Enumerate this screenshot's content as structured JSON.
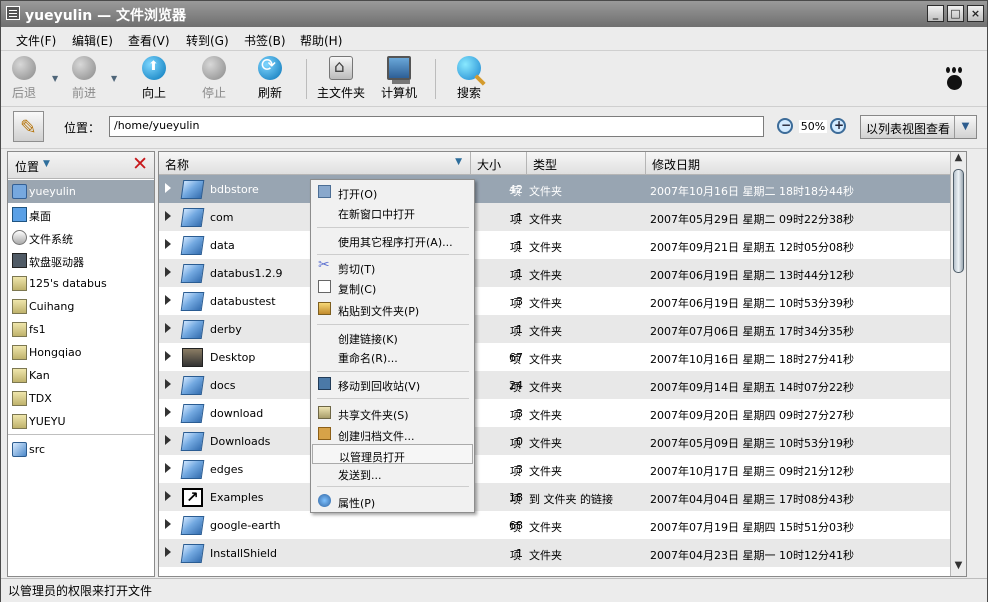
{
  "window": {
    "title": "yueyulin — 文件浏览器",
    "controls": [
      "_",
      "□",
      "×"
    ]
  },
  "menubar": [
    "文件(F)",
    "编辑(E)",
    "查看(V)",
    "转到(G)",
    "书签(B)",
    "帮助(H)"
  ],
  "toolbar": {
    "back": "后退",
    "forward": "前进",
    "up": "向上",
    "stop": "停止",
    "refresh": "刷新",
    "home": "主文件夹",
    "computer": "计算机",
    "search": "搜索"
  },
  "location": {
    "label": "位置：",
    "path": "/home/yueyulin",
    "zoom": "50%",
    "view_mode": "以列表视图查看"
  },
  "sidebar": {
    "header": "位置",
    "items": [
      {
        "label": "yueyulin",
        "icon": "home-folder-icon",
        "selected": true
      },
      {
        "label": "桌面",
        "icon": "desktop-icon"
      },
      {
        "label": "文件系统",
        "icon": "filesystem-icon"
      },
      {
        "label": "软盘驱动器",
        "icon": "floppy-icon"
      },
      {
        "label": "125's databus",
        "icon": "network-folder-icon"
      },
      {
        "label": "Cuihang",
        "icon": "network-folder-icon"
      },
      {
        "label": "fs1",
        "icon": "network-folder-icon"
      },
      {
        "label": "Hongqiao",
        "icon": "network-folder-icon"
      },
      {
        "label": "Kan",
        "icon": "network-folder-icon"
      },
      {
        "label": "TDX",
        "icon": "network-folder-icon"
      },
      {
        "label": "YUEYU",
        "icon": "network-folder-icon"
      },
      {
        "label": "src",
        "icon": "folder-icon"
      }
    ]
  },
  "filelist": {
    "columns": {
      "name": "名称",
      "size": "大小",
      "type": "类型",
      "date": "修改日期"
    },
    "rows": [
      {
        "name": "bdbstore",
        "size": "42",
        "unit": "项",
        "type": "文件夹",
        "date": "2007年10月16日 星期二 18时18分44秒",
        "selected": true
      },
      {
        "name": "com",
        "size": "1",
        "unit": "项",
        "type": "文件夹",
        "date": "2007年05月29日 星期二 09时22分38秒"
      },
      {
        "name": "data",
        "size": "1",
        "unit": "项",
        "type": "文件夹",
        "date": "2007年09月21日 星期五 12时05分08秒"
      },
      {
        "name": "databus1.2.9",
        "size": "1",
        "unit": "项",
        "type": "文件夹",
        "date": "2007年06月19日 星期二 13时44分12秒"
      },
      {
        "name": "databustest",
        "size": "3",
        "unit": "项",
        "type": "文件夹",
        "date": "2007年06月19日 星期二 10时53分39秒"
      },
      {
        "name": "derby",
        "size": "1",
        "unit": "项",
        "type": "文件夹",
        "date": "2007年07月06日 星期五 17时34分35秒"
      },
      {
        "name": "Desktop",
        "size": "67",
        "unit": "项",
        "type": "文件夹",
        "date": "2007年10月16日 星期二 18时27分41秒",
        "icon": "desktop"
      },
      {
        "name": "docs",
        "size": "24",
        "unit": "项",
        "type": "文件夹",
        "date": "2007年09月14日 星期五 14时07分22秒"
      },
      {
        "name": "download",
        "size": "3",
        "unit": "项",
        "type": "文件夹",
        "date": "2007年09月20日 星期四 09时27分27秒"
      },
      {
        "name": "Downloads",
        "size": "0",
        "unit": "项",
        "type": "文件夹",
        "date": "2007年05月09日 星期三 10时53分19秒"
      },
      {
        "name": "edges",
        "size": "3",
        "unit": "项",
        "type": "文件夹",
        "date": "2007年10月17日 星期三 09时21分12秒"
      },
      {
        "name": "Examples",
        "size": "18",
        "unit": "项",
        "type": "到 文件夹 的链接",
        "date": "2007年04月04日 星期三 17时08分43秒",
        "icon": "link"
      },
      {
        "name": "google-earth",
        "size": "68",
        "unit": "项",
        "type": "文件夹",
        "date": "2007年07月19日 星期四 15时51分03秒"
      },
      {
        "name": "InstallShield",
        "size": "1",
        "unit": "项",
        "type": "文件夹",
        "date": "2007年04月23日 星期一 10时12分41秒"
      }
    ]
  },
  "context_menu": [
    {
      "label": "打开(O)",
      "icon": "open-icon"
    },
    {
      "label": "在新窗口中打开"
    },
    {
      "label": "使用其它程序打开(A)..."
    },
    {
      "label": "剪切(T)",
      "icon": "cut-icon"
    },
    {
      "label": "复制(C)",
      "icon": "copy-icon"
    },
    {
      "label": "粘贴到文件夹(P)",
      "icon": "paste-icon"
    },
    {
      "label": "创建链接(K)"
    },
    {
      "label": "重命名(R)..."
    },
    {
      "label": "移动到回收站(V)",
      "icon": "trash-icon"
    },
    {
      "label": "共享文件夹(S)",
      "icon": "share-icon"
    },
    {
      "label": "创建归档文件...",
      "icon": "archive-icon"
    },
    {
      "label": "以管理员打开",
      "highlighted": true
    },
    {
      "label": "发送到..."
    },
    {
      "label": "属性(P)",
      "icon": "properties-icon"
    }
  ],
  "status": "以管理员的权限来打开文件"
}
